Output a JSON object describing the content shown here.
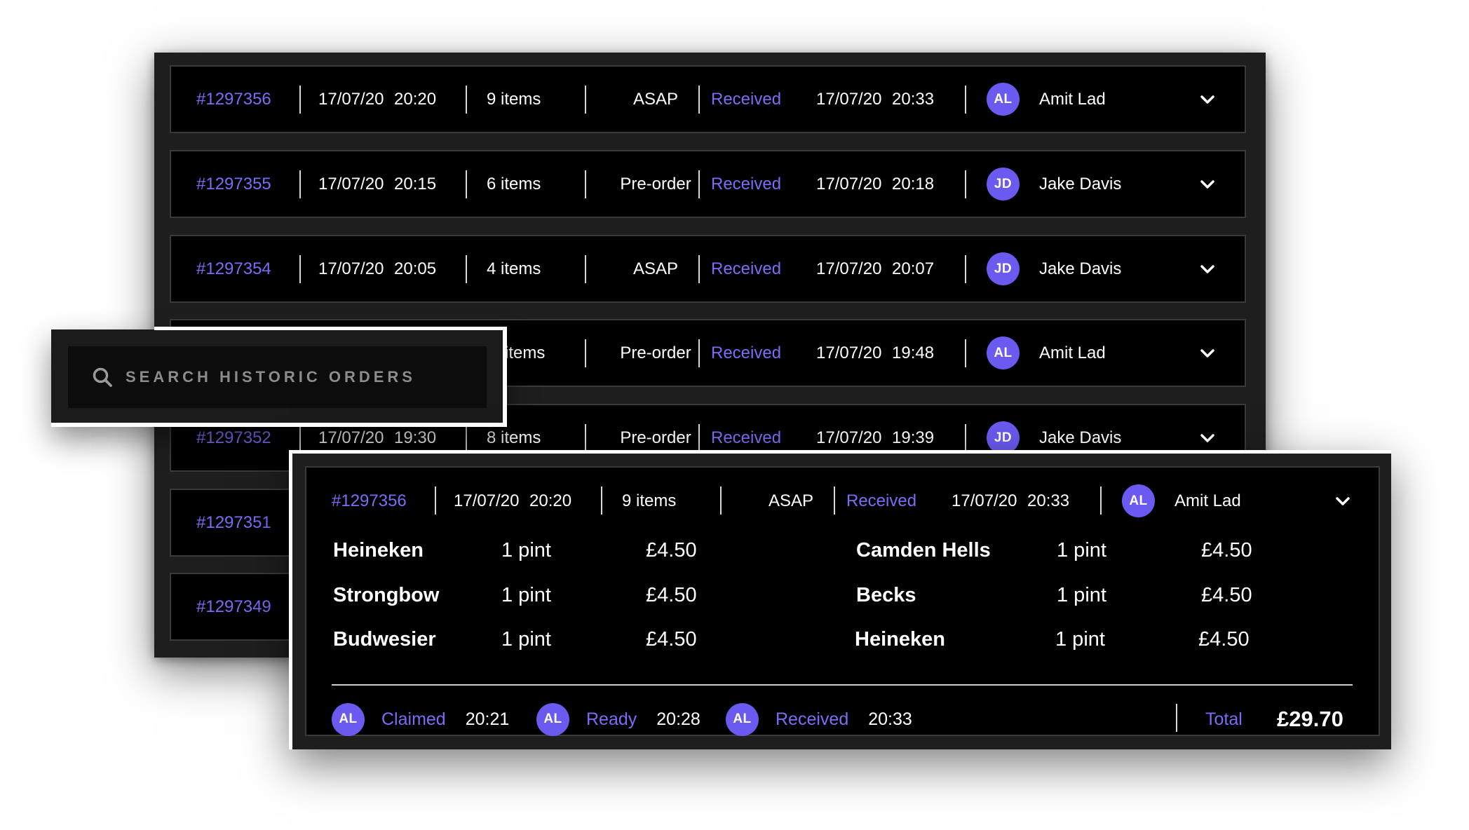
{
  "orders": [
    {
      "id": "#1297356",
      "date": "17/07/20",
      "time": "20:20",
      "items": "9 items",
      "type": "ASAP",
      "status": "Received",
      "sdate": "17/07/20",
      "stime": "20:33",
      "initials": "AL",
      "name": "Amit Lad"
    },
    {
      "id": "#1297355",
      "date": "17/07/20",
      "time": "20:15",
      "items": "6 items",
      "type": "Pre-order",
      "status": "Received",
      "sdate": "17/07/20",
      "stime": "20:18",
      "initials": "JD",
      "name": "Jake Davis"
    },
    {
      "id": "#1297354",
      "date": "17/07/20",
      "time": "20:05",
      "items": "4 items",
      "type": "ASAP",
      "status": "Received",
      "sdate": "17/07/20",
      "stime": "20:07",
      "initials": "JD",
      "name": "Jake Davis"
    },
    {
      "id": "",
      "date": "",
      "time": "",
      "items": "items",
      "type": "Pre-order",
      "status": "Received",
      "sdate": "17/07/20",
      "stime": "19:48",
      "initials": "AL",
      "name": "Amit Lad"
    },
    {
      "id": "#1297352",
      "date": "17/07/20",
      "time": "19:30",
      "items": "8 items",
      "type": "Pre-order",
      "status": "Received",
      "sdate": "17/07/20",
      "stime": "19:39",
      "initials": "JD",
      "name": "Jake Davis"
    },
    {
      "id": "#1297351"
    },
    {
      "id": "#1297349"
    }
  ],
  "search": {
    "placeholder": "SEARCH HISTORIC ORDERS"
  },
  "detail": {
    "id": "#1297356",
    "date": "17/07/20",
    "time": "20:20",
    "items": "9 items",
    "type": "ASAP",
    "status": "Received",
    "sdate": "17/07/20",
    "stime": "20:33",
    "initials": "AL",
    "name": "Amit Lad",
    "lines_left": [
      {
        "name": "Heineken",
        "qty": "1 pint",
        "price": "£4.50"
      },
      {
        "name": "Strongbow",
        "qty": "1 pint",
        "price": "£4.50"
      },
      {
        "name": "Budwesier",
        "qty": "1 pint",
        "price": "£4.50"
      }
    ],
    "lines_right": [
      {
        "name": "Camden Hells",
        "qty": "1 pint",
        "price": "£4.50"
      },
      {
        "name": "Becks",
        "qty": "1 pint",
        "price": "£4.50"
      },
      {
        "name": "Heineken",
        "qty": "1 pint",
        "price": "£4.50"
      }
    ],
    "history": [
      {
        "initials": "AL",
        "status": "Claimed",
        "time": "20:21"
      },
      {
        "initials": "AL",
        "status": "Ready",
        "time": "20:28"
      },
      {
        "initials": "AL",
        "status": "Received",
        "time": "20:33"
      }
    ],
    "total_label": "Total",
    "total_value": "£29.70"
  },
  "icons": {
    "search": "search-icon",
    "expand": "chevron-down-icon"
  },
  "colors": {
    "accent": "#7b6cf6",
    "avatar": "#6a5af0",
    "panel": "#1e1e1e",
    "row": "#000000"
  }
}
